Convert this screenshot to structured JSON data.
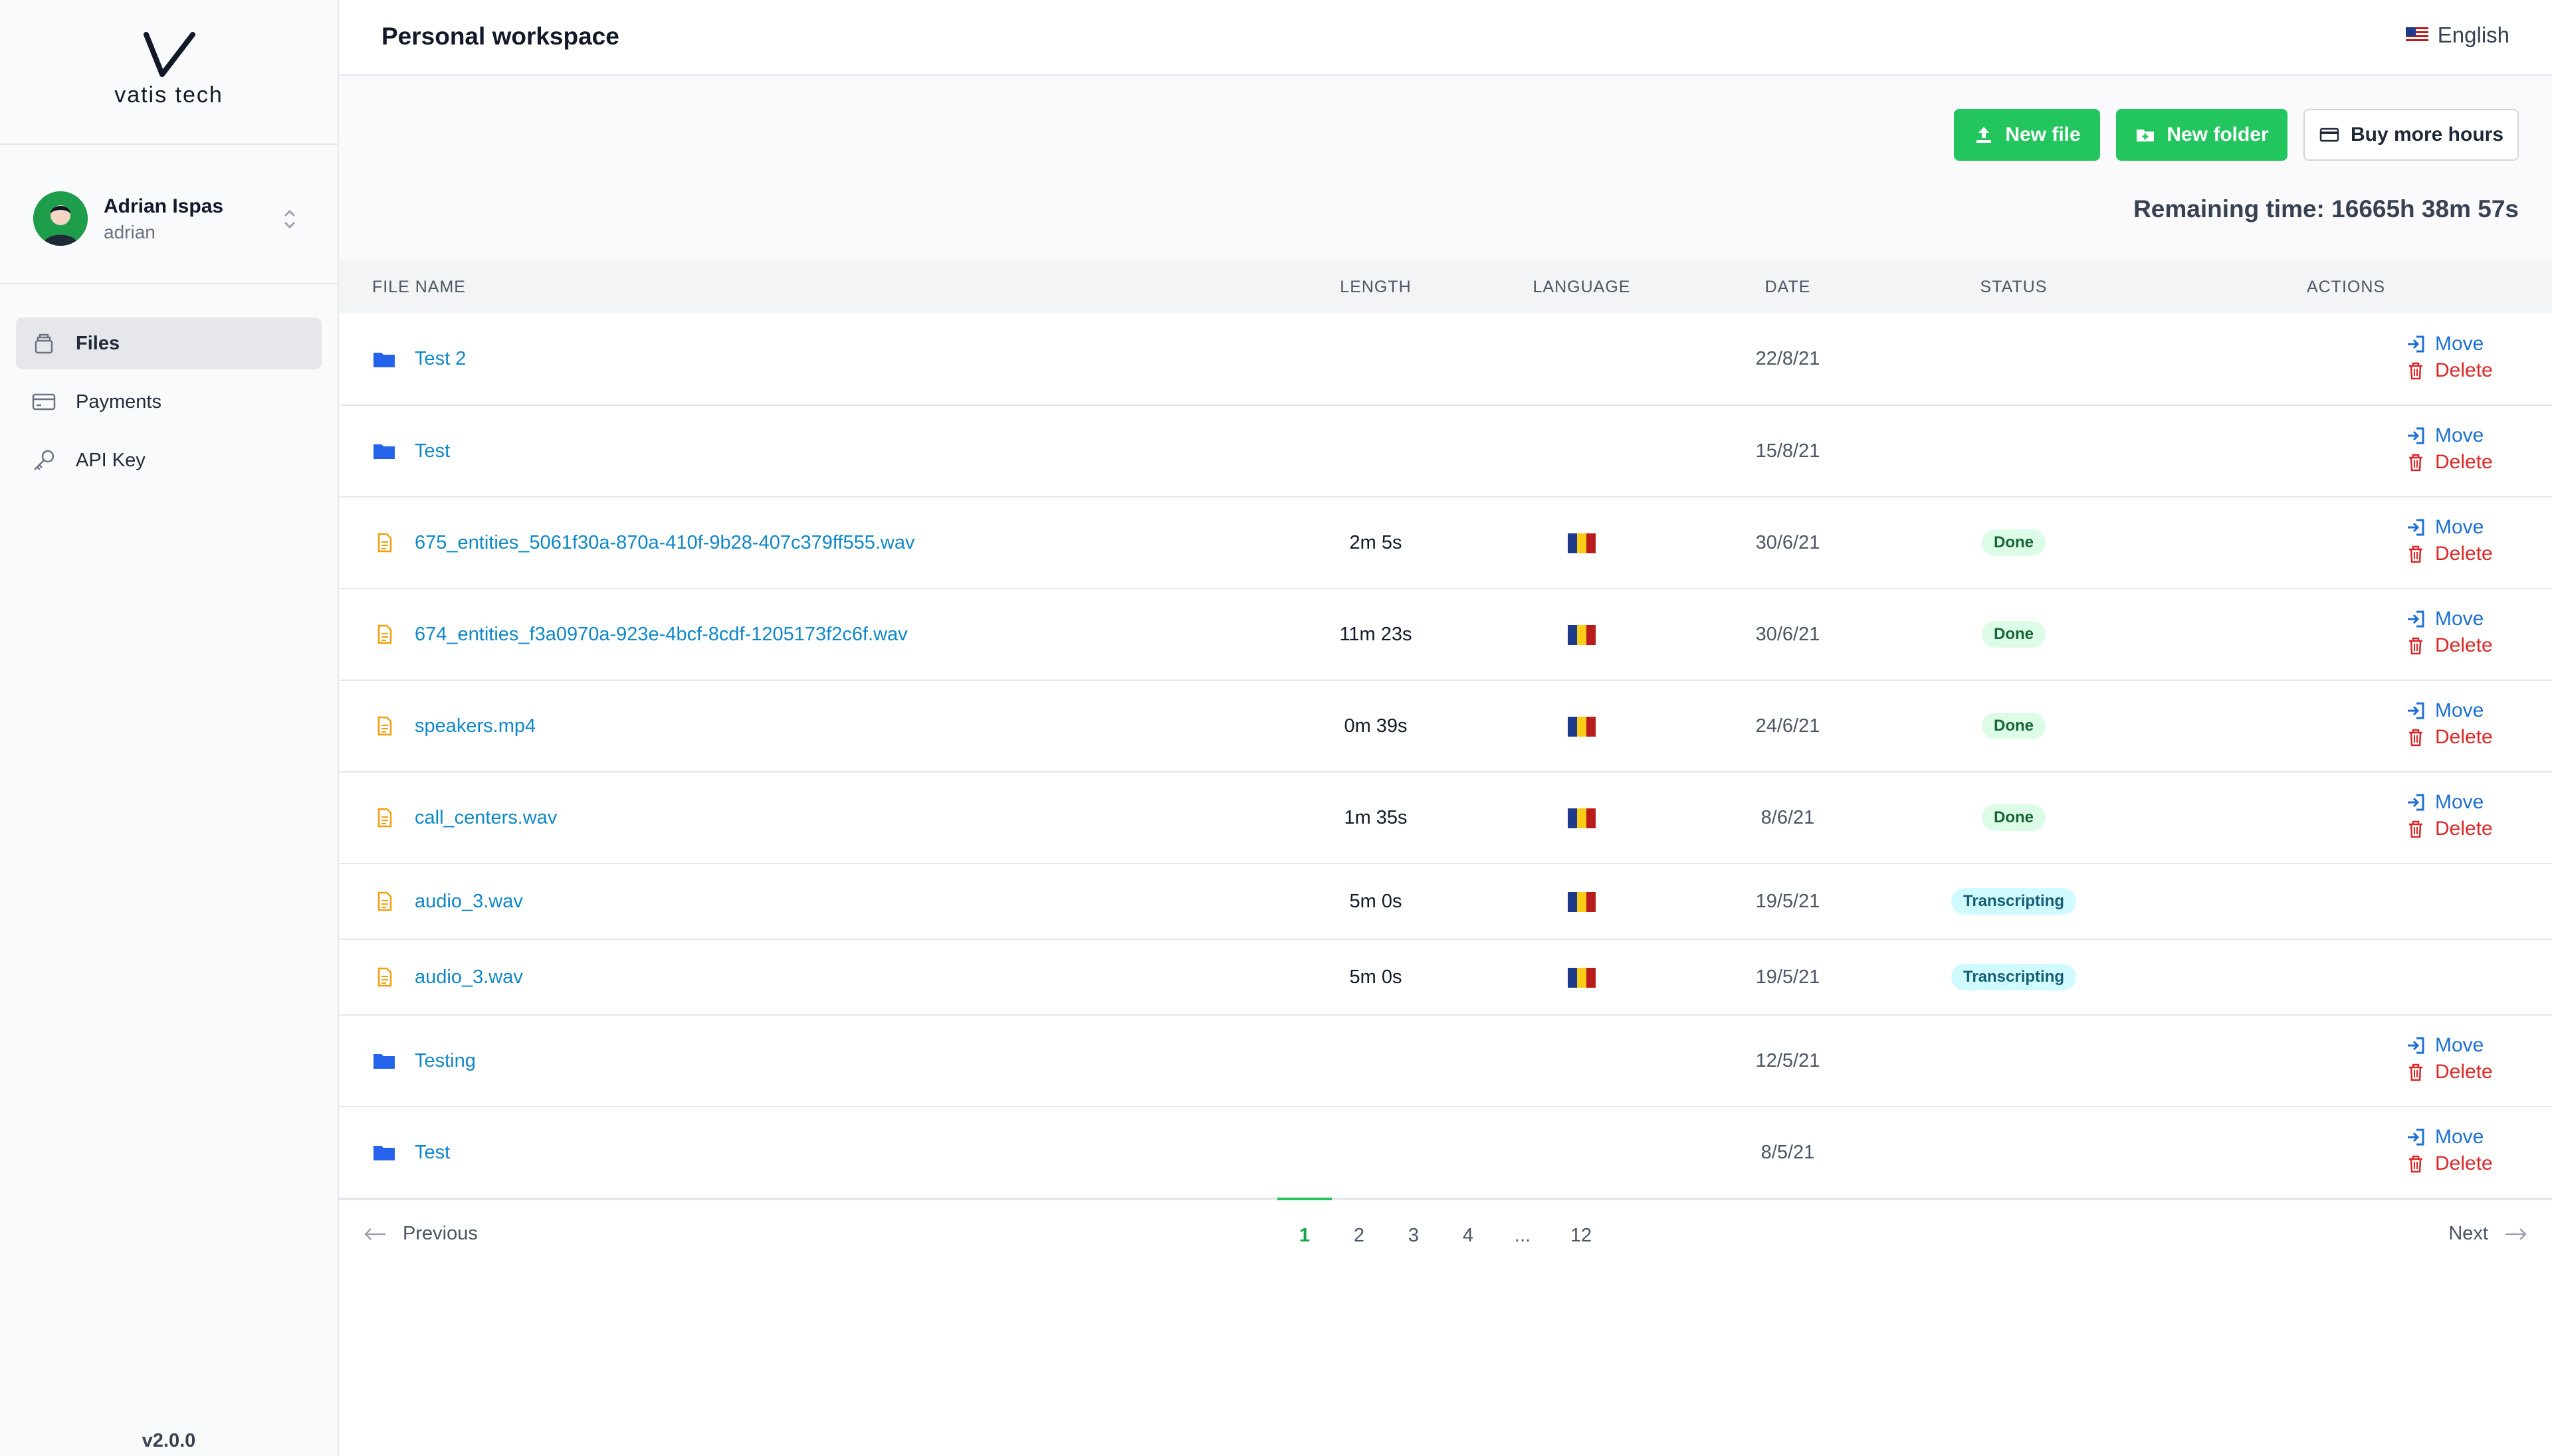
{
  "brand": {
    "name": "vatis tech",
    "version": "v2.0.0"
  },
  "user": {
    "name": "Adrian Ispas",
    "handle": "adrian"
  },
  "nav": [
    {
      "label": "Files",
      "icon": "files-icon"
    },
    {
      "label": "Payments",
      "icon": "card-icon"
    },
    {
      "label": "API Key",
      "icon": "key-icon"
    }
  ],
  "header": {
    "title": "Personal workspace",
    "language": "English"
  },
  "toolbar": {
    "new_file": "New file",
    "new_folder": "New folder",
    "buy_hours": "Buy more hours",
    "remaining": "Remaining time: 16665h 38m 57s"
  },
  "table": {
    "headers": {
      "name": "FILE NAME",
      "length": "LENGTH",
      "language": "LANGUAGE",
      "date": "DATE",
      "status": "STATUS",
      "actions": "ACTIONS"
    },
    "rows": [
      {
        "type": "folder",
        "name": "Test 2",
        "length": "",
        "lang": "",
        "date": "22/8/21",
        "status": "",
        "move": "Move",
        "delete": "Delete"
      },
      {
        "type": "folder",
        "name": "Test",
        "length": "",
        "lang": "",
        "date": "15/8/21",
        "status": "",
        "move": "Move",
        "delete": "Delete"
      },
      {
        "type": "file",
        "name": "675_entities_5061f30a-870a-410f-9b28-407c379ff555.wav",
        "length": "2m 5s",
        "lang": "ro",
        "date": "30/6/21",
        "status": "Done",
        "move": "Move",
        "delete": "Delete"
      },
      {
        "type": "file",
        "name": "674_entities_f3a0970a-923e-4bcf-8cdf-1205173f2c6f.wav",
        "length": "11m 23s",
        "lang": "ro",
        "date": "30/6/21",
        "status": "Done",
        "move": "Move",
        "delete": "Delete"
      },
      {
        "type": "file",
        "name": "speakers.mp4",
        "length": "0m 39s",
        "lang": "ro",
        "date": "24/6/21",
        "status": "Done",
        "move": "Move",
        "delete": "Delete"
      },
      {
        "type": "file",
        "name": "call_centers.wav",
        "length": "1m 35s",
        "lang": "ro",
        "date": "8/6/21",
        "status": "Done",
        "move": "Move",
        "delete": "Delete"
      },
      {
        "type": "file",
        "name": "audio_3.wav",
        "length": "5m 0s",
        "lang": "ro",
        "date": "19/5/21",
        "status": "Transcripting",
        "move": "",
        "delete": ""
      },
      {
        "type": "file",
        "name": "audio_3.wav",
        "length": "5m 0s",
        "lang": "ro",
        "date": "19/5/21",
        "status": "Transcripting",
        "move": "",
        "delete": ""
      },
      {
        "type": "folder",
        "name": "Testing",
        "length": "",
        "lang": "",
        "date": "12/5/21",
        "status": "",
        "move": "Move",
        "delete": "Delete"
      },
      {
        "type": "folder",
        "name": "Test",
        "length": "",
        "lang": "",
        "date": "8/5/21",
        "status": "",
        "move": "Move",
        "delete": "Delete"
      }
    ]
  },
  "pagination": {
    "previous": "Previous",
    "next": "Next",
    "pages": [
      "1",
      "2",
      "3",
      "4",
      "...",
      "12"
    ],
    "current": "1"
  },
  "colors": {
    "accent": "#22c55e",
    "link": "#0e87c9",
    "danger": "#dc2626",
    "folder": "#2563eb",
    "file": "#f59e0b"
  }
}
